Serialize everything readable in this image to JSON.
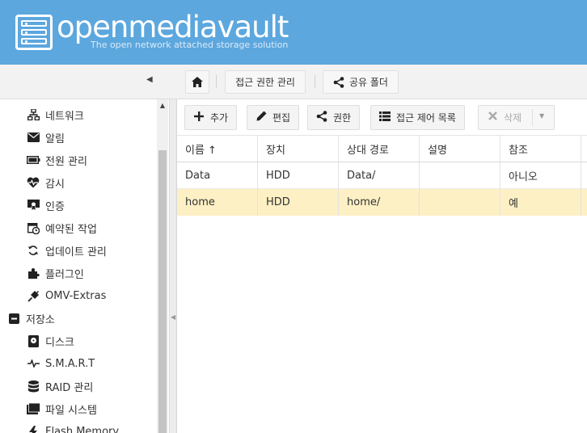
{
  "header": {
    "title": "openmediavault",
    "subtitle": "The open network attached storage solution",
    "background": "#5ca7de"
  },
  "breadcrumb": {
    "home_icon": "home-icon",
    "items": [
      "접근 권한 관리",
      "공유 폴더"
    ]
  },
  "sidebar": {
    "items": [
      {
        "label": "네트워크",
        "icon": "network-icon"
      },
      {
        "label": "알림",
        "icon": "envelope-icon"
      },
      {
        "label": "전원 관리",
        "icon": "battery-icon"
      },
      {
        "label": "감시",
        "icon": "heartbeat-icon"
      },
      {
        "label": "인증",
        "icon": "certificate-icon"
      },
      {
        "label": "예약된 작업",
        "icon": "calendar-clock-icon"
      },
      {
        "label": "업데이트 관리",
        "icon": "refresh-icon"
      },
      {
        "label": "플러그인",
        "icon": "puzzle-icon"
      },
      {
        "label": "OMV-Extras",
        "icon": "plug-icon"
      },
      {
        "label": "저장소",
        "icon": "collapse-minus-icon"
      },
      {
        "label": "디스크",
        "icon": "disk-icon"
      },
      {
        "label": "S.M.A.R.T",
        "icon": "pulse-icon"
      },
      {
        "label": "RAID 관리",
        "icon": "database-icon"
      },
      {
        "label": "파일 시스템",
        "icon": "folder-icon"
      },
      {
        "label": "Flash Memory",
        "icon": "flash-icon"
      }
    ]
  },
  "toolbar": {
    "add": "추가",
    "edit": "편집",
    "privileges": "권한",
    "acl": "접근 제어 목록",
    "delete": "삭제"
  },
  "grid": {
    "columns": [
      "이름 ↑",
      "장치",
      "상대 경로",
      "설명",
      "참조"
    ],
    "rows": [
      {
        "name": "Data",
        "device": "HDD",
        "path": "Data/",
        "description": "",
        "referenced": "아니오"
      },
      {
        "name": "home",
        "device": "HDD",
        "path": "home/",
        "description": "",
        "referenced": "예"
      }
    ],
    "selected_color": "#fdf0c4"
  }
}
